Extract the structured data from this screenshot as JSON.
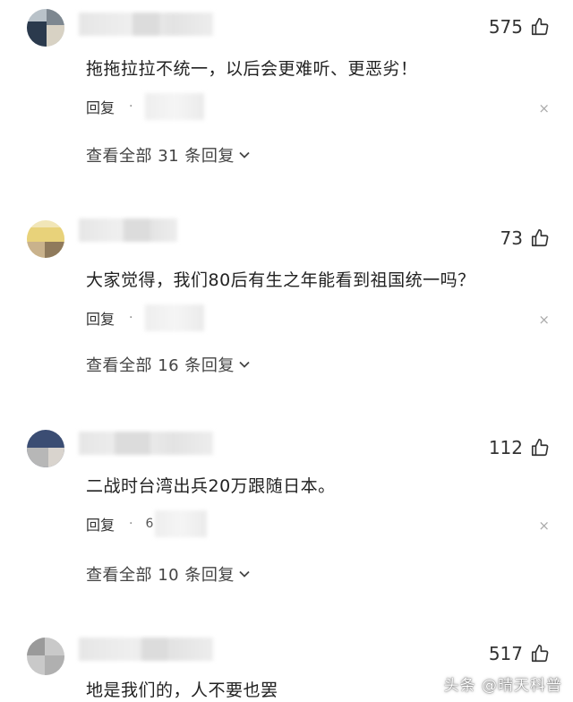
{
  "comments": [
    {
      "likes": "575",
      "text": "拖拖拉拉不统一，以后会更难听、更恶劣！",
      "reply_label": "回复",
      "time_visible": "",
      "view_all": "查看全部 31 条回复"
    },
    {
      "likes": "73",
      "text": "大家觉得，我们80后有生之年能看到祖国统一吗？",
      "reply_label": "回复",
      "time_visible": "",
      "view_all": "查看全部 16 条回复"
    },
    {
      "likes": "112",
      "text": "二战时台湾出兵20万跟随日本。",
      "reply_label": "回复",
      "time_visible": "6",
      "view_all": "查看全部 10 条回复"
    },
    {
      "likes": "517",
      "text": "地是我们的，人不要也罢",
      "reply_label": "",
      "time_visible": "",
      "view_all": ""
    }
  ],
  "reply_separator": "·",
  "close_symbol": "×",
  "watermark": "头条 @晴天科普",
  "icons": {
    "like": "thumbs-up-icon",
    "close": "close-icon",
    "chevron": "chevron-down-icon"
  }
}
